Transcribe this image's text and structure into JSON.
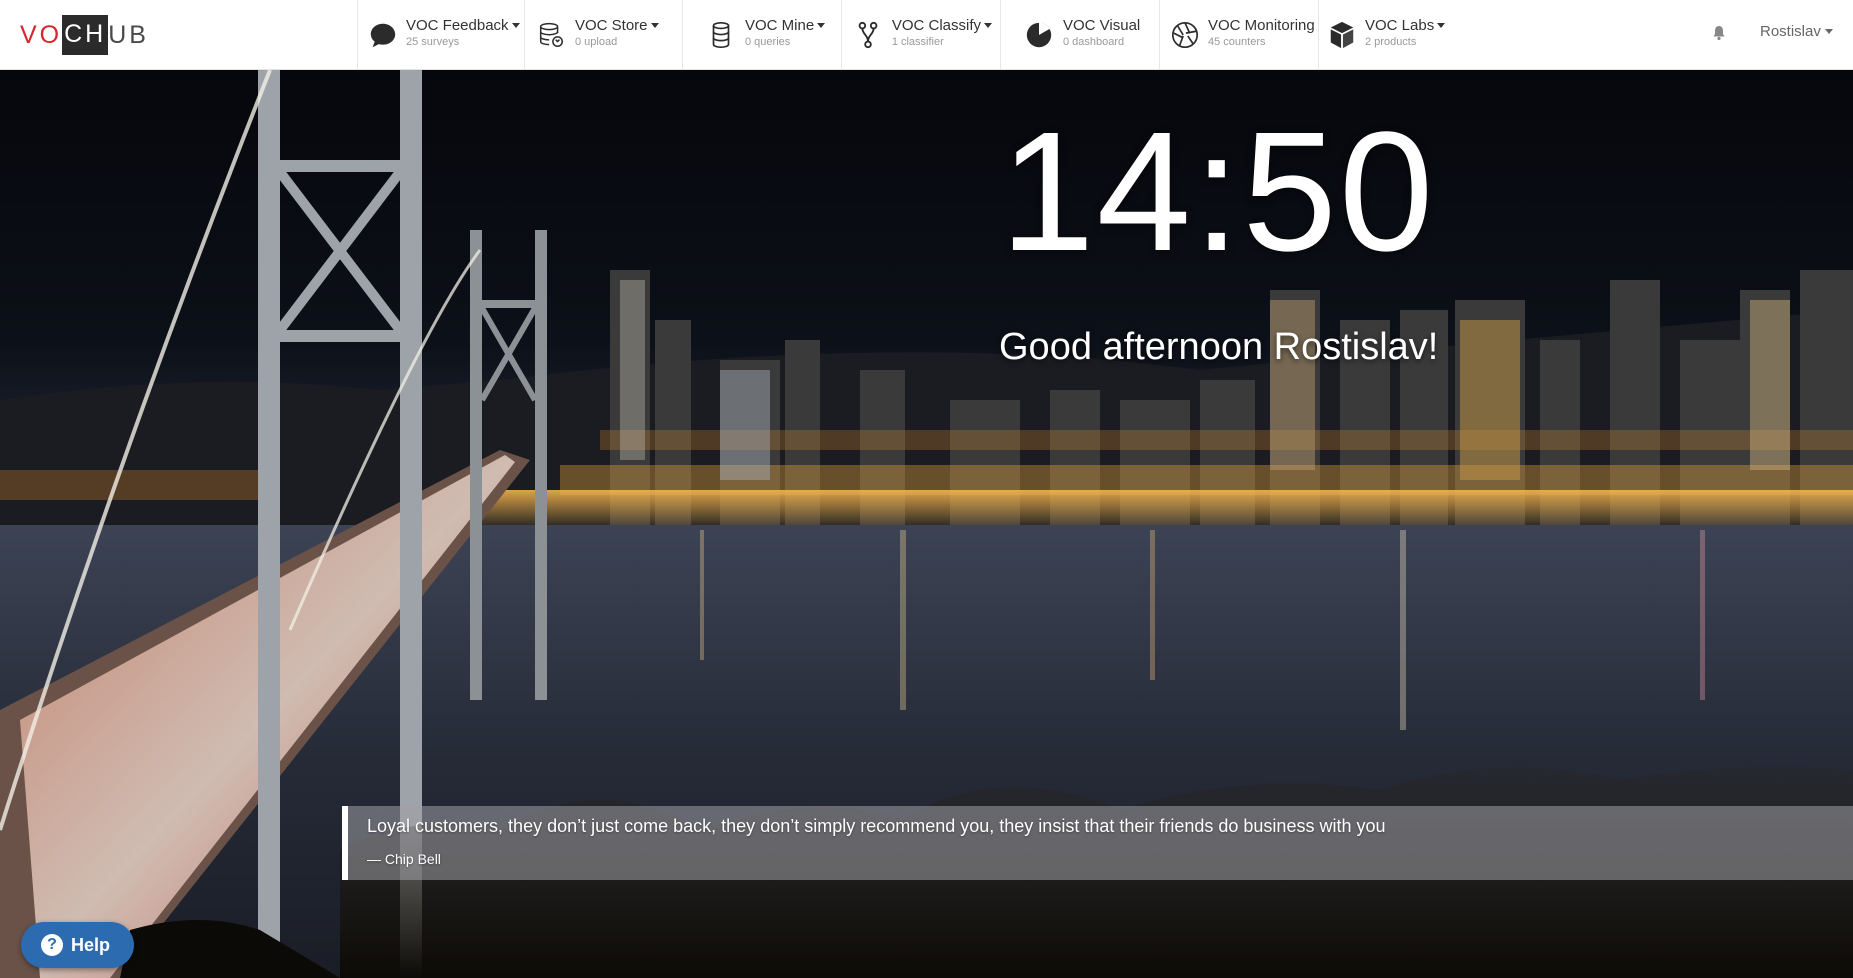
{
  "logo": {
    "part1": "VO",
    "part2": "CH",
    "part3": "UB"
  },
  "nav": [
    {
      "title": "VOC Feedback",
      "subtitle": "25 surveys",
      "icon": "speech-bubble-icon",
      "dropdown": true
    },
    {
      "title": "VOC Store",
      "subtitle": "0 upload",
      "icon": "database-sync-icon",
      "dropdown": true
    },
    {
      "title": "VOC Mine",
      "subtitle": "0 queries",
      "icon": "database-icon",
      "dropdown": true
    },
    {
      "title": "VOC Classify",
      "subtitle": "1 classifier",
      "icon": "branch-icon",
      "dropdown": true
    },
    {
      "title": "VOC Visual",
      "subtitle": "0 dashboard",
      "icon": "pie-chart-icon",
      "dropdown": false
    },
    {
      "title": "VOC Monitoring",
      "subtitle": "45 counters",
      "icon": "aperture-icon",
      "dropdown": false
    },
    {
      "title": "VOC Labs",
      "subtitle": "2 products",
      "icon": "cube-icon",
      "dropdown": true
    }
  ],
  "user": {
    "name": "Rostislav"
  },
  "hero": {
    "time": "14:50",
    "greeting": "Good afternoon Rostislav!"
  },
  "quote": {
    "text": "Loyal customers, they don’t just come back, they don’t simply recommend you, they insist that their friends do business with you",
    "author": "—  Chip Bell"
  },
  "help": {
    "label": "Help"
  },
  "colors": {
    "brand_red": "#d8252b",
    "help_blue": "#2d6bb0"
  }
}
